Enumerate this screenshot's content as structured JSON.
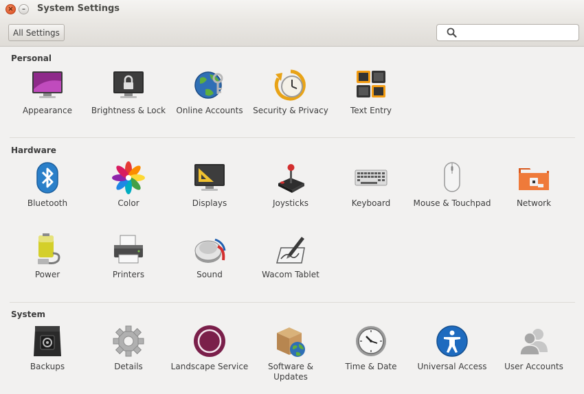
{
  "window": {
    "title": "System Settings",
    "close_glyph": "×",
    "minimize_glyph": "–"
  },
  "toolbar": {
    "all_settings_label": "All Settings",
    "search_placeholder": "",
    "search_value": ""
  },
  "sections": {
    "personal": {
      "title": "Personal",
      "items": [
        {
          "label": "Appearance",
          "icon": "appearance-icon"
        },
        {
          "label": "Brightness & Lock",
          "icon": "brightness-lock-icon"
        },
        {
          "label": "Online Accounts",
          "icon": "online-accounts-icon"
        },
        {
          "label": "Security & Privacy",
          "icon": "security-privacy-icon"
        },
        {
          "label": "Text Entry",
          "icon": "text-entry-icon"
        }
      ]
    },
    "hardware": {
      "title": "Hardware",
      "items": [
        {
          "label": "Bluetooth",
          "icon": "bluetooth-icon"
        },
        {
          "label": "Color",
          "icon": "color-icon"
        },
        {
          "label": "Displays",
          "icon": "displays-icon"
        },
        {
          "label": "Joysticks",
          "icon": "joystick-icon"
        },
        {
          "label": "Keyboard",
          "icon": "keyboard-icon"
        },
        {
          "label": "Mouse & Touchpad",
          "icon": "mouse-icon"
        },
        {
          "label": "Network",
          "icon": "network-icon"
        },
        {
          "label": "Power",
          "icon": "power-icon"
        },
        {
          "label": "Printers",
          "icon": "printer-icon"
        },
        {
          "label": "Sound",
          "icon": "sound-icon"
        },
        {
          "label": "Wacom Tablet",
          "icon": "wacom-tablet-icon"
        }
      ]
    },
    "system": {
      "title": "System",
      "items": [
        {
          "label": "Backups",
          "icon": "backups-icon"
        },
        {
          "label": "Details",
          "icon": "details-icon"
        },
        {
          "label": "Landscape Service",
          "icon": "landscape-icon"
        },
        {
          "label": "Software & Updates",
          "icon": "software-updates-icon"
        },
        {
          "label": "Time & Date",
          "icon": "clock-icon"
        },
        {
          "label": "Universal Access",
          "icon": "universal-access-icon"
        },
        {
          "label": "User Accounts",
          "icon": "user-accounts-icon"
        }
      ]
    }
  },
  "colors": {
    "background": "#f2f1f0",
    "close_button": "#df5426",
    "landscape_ring": "#7a1f4a",
    "accent_orange": "#f39c12"
  }
}
